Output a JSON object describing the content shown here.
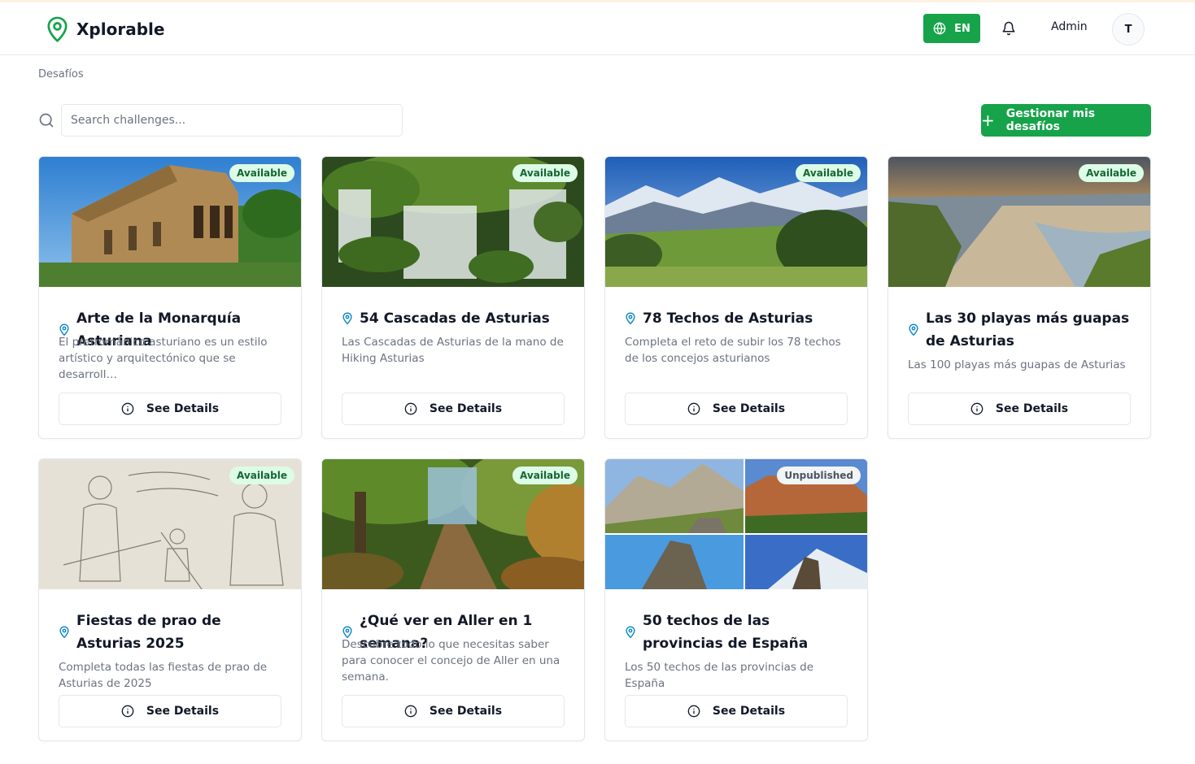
{
  "header": {
    "app_name": "Xplorable",
    "language": "EN",
    "user_name": "Admin",
    "avatar_initial": "T"
  },
  "breadcrumb": "Desafíos",
  "search": {
    "placeholder": "Search challenges...",
    "value": ""
  },
  "manage_button": {
    "icon": "+",
    "label": "Gestionar mis desafíos"
  },
  "colors": {
    "accent": "#16a34a",
    "badge_available_bg": "#dcfce7",
    "badge_available_text": "#166534",
    "pin": "#0284c7"
  },
  "challenges": [
    {
      "title": "Arte de la Monarquía Asturiana",
      "description": "El prerrománico asturiano es un estilo artístico y arquitectónico que se desarroll…",
      "status": "Available",
      "button": "See Details"
    },
    {
      "title": "54 Cascadas de Asturias",
      "description": "Las Cascadas de Asturias de la mano de Hiking Asturias",
      "status": "Available",
      "button": "See Details"
    },
    {
      "title": "78 Techos de Asturias",
      "description": "Completa el reto de subir los 78 techos de los concejos asturianos",
      "status": "Available",
      "button": "See Details"
    },
    {
      "title": "Las 30 playas más guapas de Asturias",
      "description": "Las 100 playas más guapas de Asturias",
      "status": "Available",
      "button": "See Details"
    },
    {
      "title": "Fiestas de prao de Asturias 2025",
      "description": "Completa todas las fiestas de prao de Asturias de 2025",
      "status": "Available",
      "button": "See Details"
    },
    {
      "title": "¿Qué ver en Aller en 1 semana?",
      "description": "Descubre todo lo que necesitas saber para conocer el concejo de Aller en una semana.",
      "status": "Available",
      "button": "See Details"
    },
    {
      "title": "50 techos de las provincias de España",
      "description": "Los 50 techos de las provincias de España",
      "status": "Unpublished",
      "button": "See Details"
    }
  ]
}
